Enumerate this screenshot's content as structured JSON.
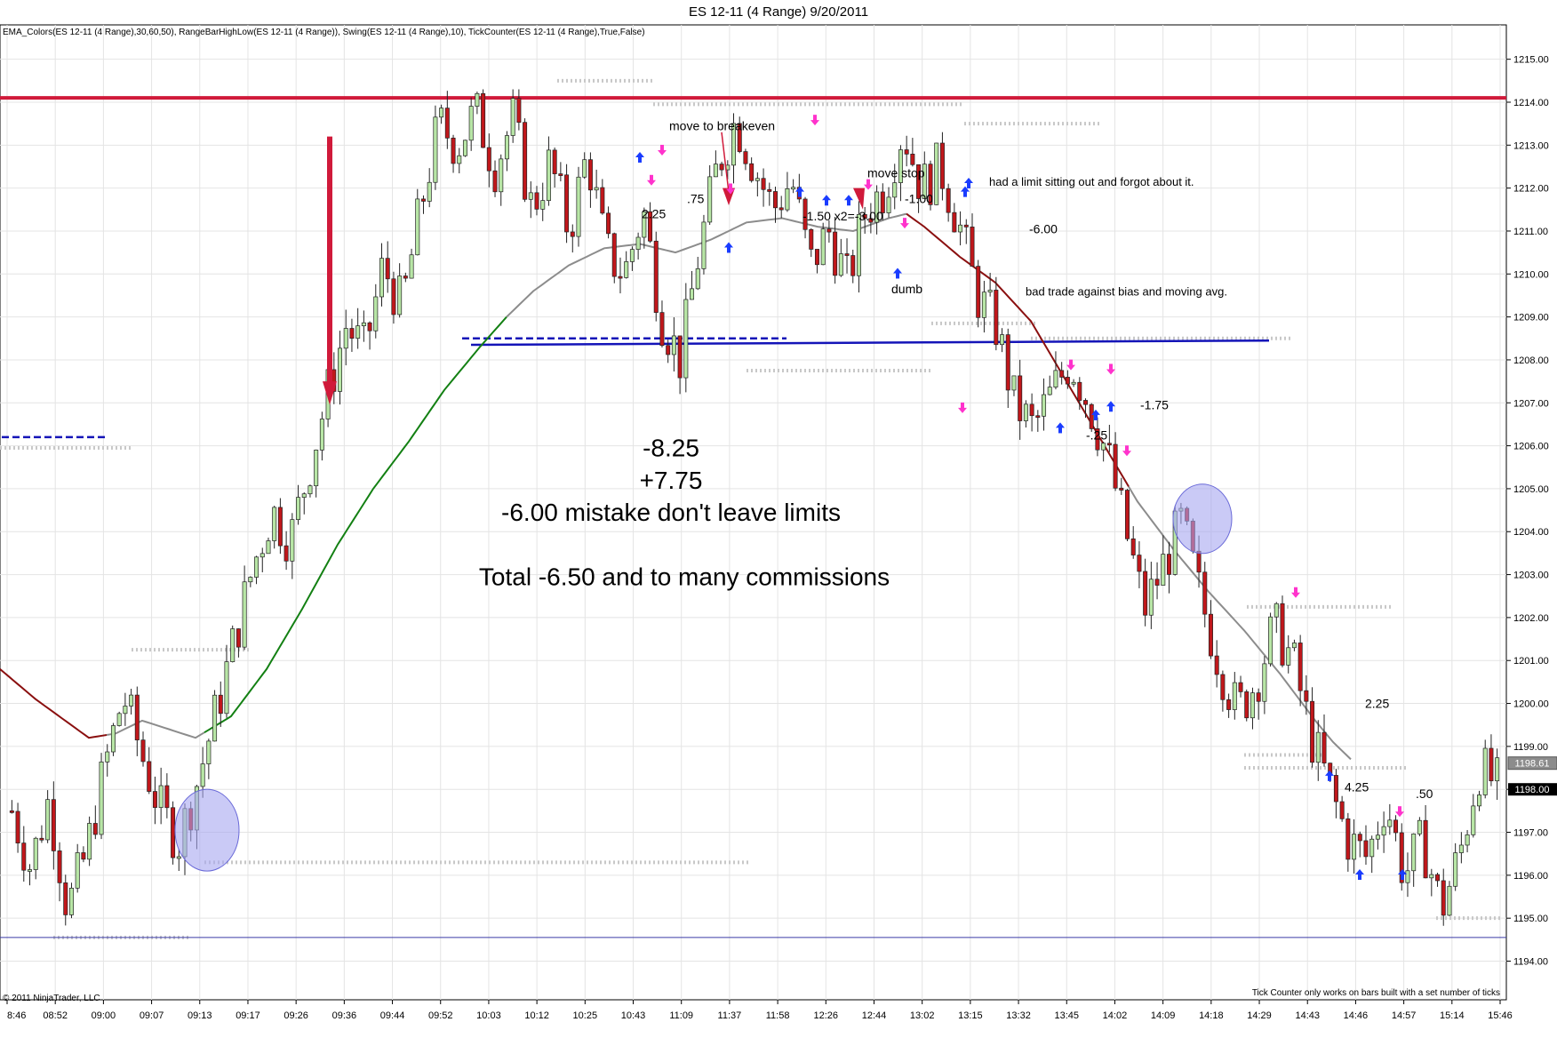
{
  "title": "ES 12-11 (4 Range)  9/20/2011",
  "indicators_label": "EMA_Colors(ES 12-11 (4 Range),30,60,50), RangeBarHighLow(ES 12-11 (4 Range)), Swing(ES 12-11 (4 Range),10), TickCounter(ES 12-11 (4 Range),True,False)",
  "copyright": "© 2011 NinjaTrader, LLC",
  "tick_counter_note": "Tick Counter only works on bars built with a set number of ticks",
  "price_tags": {
    "ema": "1198.61",
    "last": "1198.00"
  },
  "colors": {
    "up_bar": "#b8e6a6",
    "down_bar": "#c0171b",
    "resistance": "#d01a3a",
    "support": "#1414b8",
    "ema_green": "#138013",
    "ema_red": "#8a0f0f",
    "ema_gray": "#8c8c8c",
    "circle": "#a7a7f0",
    "pink_arrow": "#ff33cc",
    "blue_arrow": "#1a3cff"
  },
  "annotations": {
    "move_to_breakeven": "move to breakeven",
    "move_stop": "move stop",
    "had_a_limit": "had a limit sitting out and forgot about it.",
    "bad_trade": "bad trade against bias and moving avg.",
    "dumb": "dumb",
    "a_225": "2.25",
    "a_75": ".75",
    "a_150": "-1.50 x2=-3.00",
    "a_100": "-1.00",
    "a_600": "-6.00",
    "a_25": "-.25",
    "a_175": "-1.75",
    "a_225b": "2.25",
    "a_425": "4.25",
    "a_50": ".50",
    "summary_1": "-8.25",
    "summary_2": "+7.75",
    "summary_3": "-6.00 mistake don't leave limits",
    "summary_4": "Total -6.50 and to many commissions"
  },
  "chart_data": {
    "type": "candlestick",
    "y_ticks": [
      1194,
      1195,
      1196,
      1197,
      1198,
      1199,
      1200,
      1201,
      1202,
      1203,
      1204,
      1205,
      1206,
      1207,
      1208,
      1209,
      1210,
      1211,
      1212,
      1213,
      1214,
      1215
    ],
    "y_tick_labels": [
      "1194.00",
      "1195.00",
      "1196.00",
      "1197.00",
      "1198.00",
      "1199.00",
      "1200.00",
      "1201.00",
      "1202.00",
      "1203.00",
      "1204.00",
      "1205.00",
      "1206.00",
      "1207.00",
      "1208.00",
      "1209.00",
      "1210.00",
      "1211.00",
      "1212.00",
      "1213.00",
      "1214.00",
      "1215.00"
    ],
    "ylim": [
      1193.1,
      1215.8
    ],
    "x_ticks": [
      "8:46",
      "08:52",
      "09:00",
      "09:07",
      "09:13",
      "09:17",
      "09:26",
      "09:36",
      "09:44",
      "09:52",
      "10:03",
      "10:12",
      "10:25",
      "10:43",
      "11:09",
      "11:37",
      "11:58",
      "12:26",
      "12:44",
      "13:02",
      "13:15",
      "13:32",
      "13:45",
      "14:02",
      "14:09",
      "14:18",
      "14:29",
      "14:43",
      "14:46",
      "14:57",
      "15:14",
      "15:46"
    ],
    "resistance_level": 1214.1,
    "support_level": 1208.4,
    "low_level": 1194.55,
    "close_path": [
      1197.5,
      1196.2,
      1197.8,
      1195.2,
      1196.5,
      1198.5,
      1200.2,
      1198.8,
      1197.5,
      1196.8,
      1198.2,
      1199.8,
      1201.5,
      1203.2,
      1204.5,
      1203.8,
      1205.5,
      1207.2,
      1208.8,
      1208.2,
      1210.2,
      1209.2,
      1211.5,
      1213.5,
      1213.0,
      1213.8,
      1212.5,
      1213.6,
      1211.5,
      1212.6,
      1211.0,
      1212.8,
      1210.5,
      1210.0,
      1211.5,
      1209.0,
      1208.0,
      1210.5,
      1212.5,
      1213.6,
      1212.5,
      1211.5,
      1212.2,
      1210.2,
      1211.0,
      1209.8,
      1211.5,
      1212.0,
      1213.4,
      1212.0,
      1212.5,
      1211.2,
      1209.5,
      1208.8,
      1207.0,
      1206.4,
      1207.2,
      1208.0,
      1207.0,
      1205.8,
      1204.0,
      1202.2,
      1203.2,
      1204.2,
      1202.5,
      1201.0,
      1199.8,
      1200.5,
      1201.8,
      1201.0,
      1199.2,
      1198.0,
      1196.8,
      1196.4,
      1197.8,
      1196.0,
      1196.8,
      1195.2,
      1196.5,
      1198.5,
      1198.1
    ],
    "ema_path": [
      [
        0,
        1200.8
      ],
      [
        40,
        1200.1
      ],
      [
        100,
        1199.2
      ],
      [
        130,
        1199.3
      ],
      [
        160,
        1199.6
      ],
      [
        190,
        1199.4
      ],
      [
        220,
        1199.2
      ],
      [
        260,
        1199.7
      ],
      [
        300,
        1200.8
      ],
      [
        340,
        1202.2
      ],
      [
        380,
        1203.7
      ],
      [
        420,
        1205.0
      ],
      [
        460,
        1206.1
      ],
      [
        500,
        1207.3
      ],
      [
        540,
        1208.3
      ],
      [
        570,
        1209.0
      ],
      [
        600,
        1209.6
      ],
      [
        640,
        1210.2
      ],
      [
        680,
        1210.6
      ],
      [
        720,
        1210.7
      ],
      [
        760,
        1210.5
      ],
      [
        800,
        1210.8
      ],
      [
        840,
        1211.2
      ],
      [
        880,
        1211.3
      ],
      [
        920,
        1211.1
      ],
      [
        960,
        1211.0
      ],
      [
        1000,
        1211.3
      ],
      [
        1020,
        1211.4
      ],
      [
        1040,
        1211.1
      ],
      [
        1080,
        1210.4
      ],
      [
        1120,
        1209.8
      ],
      [
        1160,
        1208.9
      ],
      [
        1200,
        1207.5
      ],
      [
        1240,
        1206.1
      ],
      [
        1280,
        1204.7
      ],
      [
        1320,
        1203.6
      ],
      [
        1360,
        1202.6
      ],
      [
        1400,
        1201.7
      ],
      [
        1440,
        1200.7
      ],
      [
        1480,
        1199.6
      ],
      [
        1500,
        1199.1
      ],
      [
        1520,
        1198.7
      ]
    ],
    "ema_segments": [
      {
        "from": 0,
        "to": 120,
        "color": "red"
      },
      {
        "from": 120,
        "to": 230,
        "color": "gray"
      },
      {
        "from": 230,
        "to": 570,
        "color": "green"
      },
      {
        "from": 570,
        "to": 1020,
        "color": "gray"
      },
      {
        "from": 1020,
        "to": 1270,
        "color": "red"
      },
      {
        "from": 1270,
        "to": 1520,
        "color": "gray"
      }
    ],
    "grid": true
  }
}
